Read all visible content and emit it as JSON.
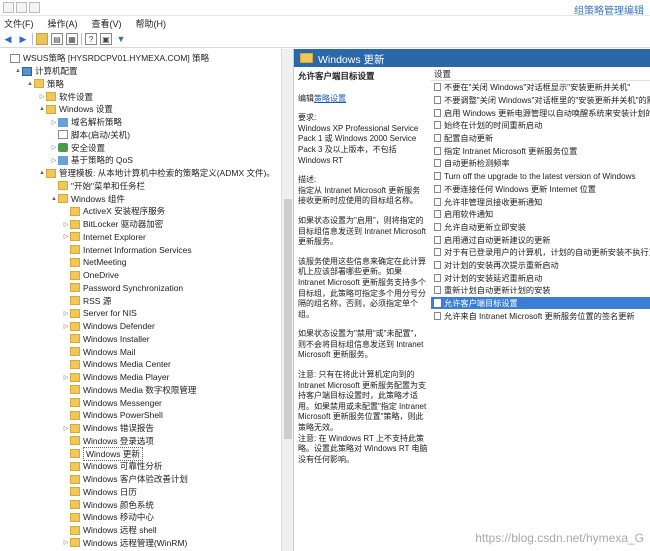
{
  "window": {
    "title": "组策略管理编辑"
  },
  "menu": [
    "文件(F)",
    "操作(A)",
    "查看(V)",
    "帮助(H)"
  ],
  "tree": {
    "items": [
      {
        "label": "WSUS策略 [HYSRDCPV01.HYMEXA.COM] 策略",
        "indent": 0,
        "icon": "doc",
        "arrow": ""
      },
      {
        "label": "计算机配置",
        "indent": 1,
        "icon": "pc",
        "arrow": "▲"
      },
      {
        "label": "策略",
        "indent": 2,
        "icon": "folder",
        "arrow": "▲"
      },
      {
        "label": "软件设置",
        "indent": 3,
        "icon": "folder",
        "arrow": "▷"
      },
      {
        "label": "Windows 设置",
        "indent": 3,
        "icon": "folder",
        "arrow": "▲"
      },
      {
        "label": "域名解析策略",
        "indent": 4,
        "icon": "chart",
        "arrow": "▷"
      },
      {
        "label": "脚本(启动/关机)",
        "indent": 4,
        "icon": "doc",
        "arrow": ""
      },
      {
        "label": "安全设置",
        "indent": 4,
        "icon": "shield",
        "arrow": "▷"
      },
      {
        "label": "基于策略的 QoS",
        "indent": 4,
        "icon": "chart",
        "arrow": "▷"
      },
      {
        "label": "管理模板: 从本地计算机中检索的策略定义(ADMX 文件)。",
        "indent": 3,
        "icon": "folder",
        "arrow": "▲"
      },
      {
        "label": "\"开始\"菜单和任务栏",
        "indent": 4,
        "icon": "folder",
        "arrow": ""
      },
      {
        "label": "Windows 组件",
        "indent": 4,
        "icon": "folder",
        "arrow": "▲"
      },
      {
        "label": "ActiveX 安装程序服务",
        "indent": 5,
        "icon": "folder",
        "arrow": ""
      },
      {
        "label": "BitLocker 驱动器加密",
        "indent": 5,
        "icon": "folder",
        "arrow": "▷"
      },
      {
        "label": "Internet Explorer",
        "indent": 5,
        "icon": "folder",
        "arrow": "▷"
      },
      {
        "label": "Internet Information Services",
        "indent": 5,
        "icon": "folder",
        "arrow": ""
      },
      {
        "label": "NetMeeting",
        "indent": 5,
        "icon": "folder",
        "arrow": ""
      },
      {
        "label": "OneDrive",
        "indent": 5,
        "icon": "folder",
        "arrow": ""
      },
      {
        "label": "Password Synchronization",
        "indent": 5,
        "icon": "folder",
        "arrow": ""
      },
      {
        "label": "RSS 源",
        "indent": 5,
        "icon": "folder",
        "arrow": ""
      },
      {
        "label": "Server for NIS",
        "indent": 5,
        "icon": "folder",
        "arrow": "▷"
      },
      {
        "label": "Windows Defender",
        "indent": 5,
        "icon": "folder",
        "arrow": "▷"
      },
      {
        "label": "Windows Installer",
        "indent": 5,
        "icon": "folder",
        "arrow": ""
      },
      {
        "label": "Windows Mail",
        "indent": 5,
        "icon": "folder",
        "arrow": ""
      },
      {
        "label": "Windows Media Center",
        "indent": 5,
        "icon": "folder",
        "arrow": ""
      },
      {
        "label": "Windows Media Player",
        "indent": 5,
        "icon": "folder",
        "arrow": "▷"
      },
      {
        "label": "Windows Media 数字权限管理",
        "indent": 5,
        "icon": "folder",
        "arrow": ""
      },
      {
        "label": "Windows Messenger",
        "indent": 5,
        "icon": "folder",
        "arrow": ""
      },
      {
        "label": "Windows PowerShell",
        "indent": 5,
        "icon": "folder",
        "arrow": ""
      },
      {
        "label": "Windows 错误报告",
        "indent": 5,
        "icon": "folder",
        "arrow": "▷"
      },
      {
        "label": "Windows 登录选项",
        "indent": 5,
        "icon": "folder",
        "arrow": ""
      },
      {
        "label": "Windows 更新",
        "indent": 5,
        "icon": "folder",
        "arrow": "",
        "selected": true
      },
      {
        "label": "Windows 可靠性分析",
        "indent": 5,
        "icon": "folder",
        "arrow": ""
      },
      {
        "label": "Windows 客户体验改善计划",
        "indent": 5,
        "icon": "folder",
        "arrow": ""
      },
      {
        "label": "Windows 日历",
        "indent": 5,
        "icon": "folder",
        "arrow": ""
      },
      {
        "label": "Windows 颜色系统",
        "indent": 5,
        "icon": "folder",
        "arrow": ""
      },
      {
        "label": "Windows 移动中心",
        "indent": 5,
        "icon": "folder",
        "arrow": ""
      },
      {
        "label": "Windows 远程 shell",
        "indent": 5,
        "icon": "folder",
        "arrow": ""
      },
      {
        "label": "Windows 远程管理(WinRM)",
        "indent": 5,
        "icon": "folder",
        "arrow": "▷"
      }
    ]
  },
  "right": {
    "header": "Windows 更新",
    "desc": {
      "title": "允许客户端目标设置",
      "edit_prefix": "编辑",
      "edit_link": "策略设置",
      "paras": [
        "要求:\nWindows XP Professional Service Pack 1 或 Windows 2000 Service Pack 3 及以上版本，不包括 Windows RT",
        "描述:\n指定从 Intranet Microsoft 更新服务接收更新时应使用的目标组名称。",
        "如果状态设置为\"启用\"，则将指定的目标组信息发送到 Intranet Microsoft 更新服务。",
        "该服务使用这些信息来确定在此计算机上应该部署哪些更新。如果 Intranet Microsoft 更新服务支持多个目标组，此策略可指定多个用分号分隔的组名称，否则，必须指定单个组。",
        "如果状态设置为\"禁用\"或\"未配置\"，则不会将目标组信息发送到 Intranet Microsoft 更新服务。",
        "注意: 只有在将此计算机定向到的 Intranet Microsoft 更新服务配置为支持客户端目标设置时，此策略才适用。如果禁用或未配置\"指定 Intranet Microsoft 更新服务位置\"策略，则此策略无效。\n注意: 在 Windows RT 上不支持此策略。设置此策略对 Windows RT 电脑没有任何影响。"
      ]
    },
    "column_header": "设置",
    "settings": [
      "不要在\"关闭 Windows\"对话框显示\"安装更新并关机\"",
      "不要调整\"关闭 Windows\"对话框里的\"安装更新并关机\"的默认选项",
      "启用 Windows 更新电源管理以自动唤醒系统来安装计划的更新",
      "始终在计划的时间重新启动",
      "配置自动更新",
      "指定 Intranet Microsoft 更新服务位置",
      "自动更新检测频率",
      "Turn off the upgrade to the latest version of Windows",
      "不要连接任何 Windows 更新 Internet 位置",
      "允许非管理员接收更新通知",
      "启用软件通知",
      "允许自动更新立即安装",
      "启用通过自动更新建议的更新",
      "对于有已登录用户的计算机，计划的自动更新安装不执行重启",
      "对计划的安装再次提示重新启动",
      "对计划的安装延迟重新启动",
      "重新计划自动更新计划的安装",
      "允许客户端目标设置",
      "允许来自 Intranet Microsoft 更新服务位置的签名更新"
    ],
    "selected_setting": 17
  },
  "watermark": "https://blog.csdn.net/hymexa_G"
}
